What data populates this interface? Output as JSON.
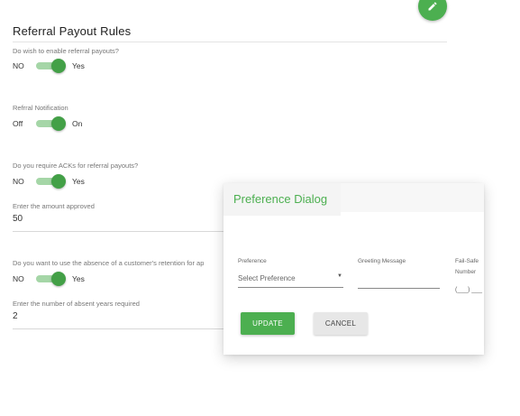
{
  "page": {
    "title": "Referral Payout Rules",
    "accent_color": "#4caf50",
    "edit_icon": "pencil-icon"
  },
  "settings": {
    "enable_payouts": {
      "question": "Do wish to enable referral payouts?",
      "off_label": "NO",
      "on_label": "Yes",
      "state": "on"
    },
    "notification": {
      "question": "Refrral Notification",
      "off_label": "Off",
      "on_label": "On",
      "state": "on"
    },
    "acks": {
      "question": "Do you require ACKs for referral payouts?",
      "off_label": "NO",
      "on_label": "Yes",
      "state": "on"
    },
    "amount": {
      "label": "Enter the amount approved",
      "value": "50"
    },
    "retention": {
      "question": "Do you want to use the absence of a customer's retention for ap",
      "off_label": "NO",
      "on_label": "Yes",
      "state": "on"
    },
    "absent_years": {
      "label": "Enter the number of absent years required",
      "value": "2"
    }
  },
  "dialog": {
    "title": "Preference Dialog",
    "preference_label": "Preference",
    "preference_value": "Select Preference",
    "greeting_label": "Greeting Message",
    "greeting_value": "",
    "failsafe_label_1": "Fail-Safe",
    "failsafe_label_2": "Number",
    "failsafe_value": "(___) ___",
    "update_label": "UPDATE",
    "cancel_label": "CANCEL"
  }
}
